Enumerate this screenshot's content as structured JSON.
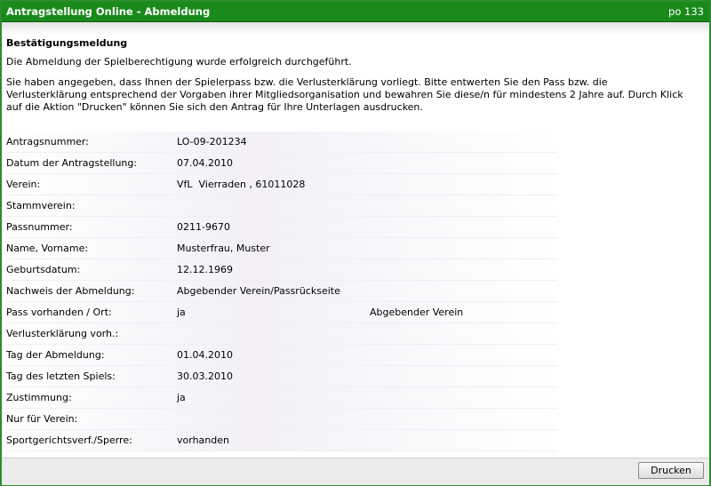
{
  "header": {
    "title": "Antragstellung Online - Abmeldung",
    "code": "po 133"
  },
  "confirmation": {
    "heading": "Bestätigungsmeldung",
    "message1": "Die Abmeldung der Spielberechtigung wurde erfolgreich durchgeführt.",
    "message2": "Sie haben angegeben, dass Ihnen der Spielerpass bzw. die Verlusterklärung vorliegt. Bitte entwerten Sie den Pass bzw. die Verlusterklärung entsprechend der Vorgaben ihrer Mitgliedsorganisation und bewahren Sie diese/n für mindestens 2 Jahre auf. Durch Klick auf die Aktion \"Drucken\" können Sie sich den Antrag für Ihre Unterlagen ausdrucken."
  },
  "fields": [
    {
      "label": "Antragsnummer:",
      "value": "LO-09-201234",
      "extra": ""
    },
    {
      "label": "Datum der Antragstellung:",
      "value": "07.04.2010",
      "extra": ""
    },
    {
      "label": "Verein:",
      "value": "VfL  Vierraden , 61011028",
      "extra": ""
    },
    {
      "label": "Stammverein:",
      "value": "",
      "extra": ""
    },
    {
      "label": "Passnummer:",
      "value": "0211-9670",
      "extra": ""
    },
    {
      "label": "Name, Vorname:",
      "value": "Musterfrau, Muster",
      "extra": ""
    },
    {
      "label": "Geburtsdatum:",
      "value": "12.12.1969",
      "extra": ""
    },
    {
      "label": "Nachweis der Abmeldung:",
      "value": "Abgebender Verein/Passrückseite",
      "extra": ""
    },
    {
      "label": "Pass vorhanden / Ort:",
      "value": "ja",
      "extra": "Abgebender Verein"
    },
    {
      "label": "Verlusterklärung vorh.:",
      "value": "",
      "extra": ""
    },
    {
      "label": "Tag der Abmeldung:",
      "value": "01.04.2010",
      "extra": ""
    },
    {
      "label": "Tag des letzten Spiels:",
      "value": "30.03.2010",
      "extra": ""
    },
    {
      "label": "Zustimmung:",
      "value": "ja",
      "extra": ""
    },
    {
      "label": "Nur für Verein:",
      "value": "",
      "extra": ""
    },
    {
      "label": "Sportgerichtsverf./Sperre:",
      "value": "vorhanden",
      "extra": ""
    }
  ],
  "footer": {
    "print_label": "Drucken"
  },
  "colors": {
    "titlebar": "#1a8a1a",
    "border": "#2e8b2e"
  }
}
